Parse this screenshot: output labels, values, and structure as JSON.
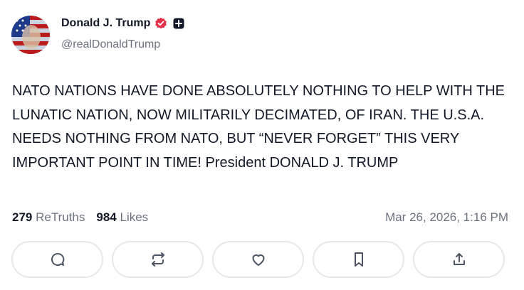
{
  "author": {
    "display_name": "Donald J. Trump",
    "handle": "@realDonaldTrump"
  },
  "post": {
    "text": "NATO NATIONS HAVE DONE ABSOLUTELY NOTHING TO HELP WITH THE LUNATIC NATION, NOW MILITARILY DECIMATED, OF IRAN. THE U.S.A. NEEDS NOTHING FROM NATO, BUT “NEVER FORGET” THIS VERY IMPORTANT POINT IN TIME! President DONALD J. TRUMP",
    "retruths_count": "279",
    "retruths_label": "ReTruths",
    "likes_count": "984",
    "likes_label": "Likes",
    "timestamp": "Mar 26, 2026, 1:16 PM"
  },
  "actions": [
    "reply-icon",
    "retruth-icon",
    "like-icon",
    "bookmark-icon",
    "share-icon"
  ],
  "colors": {
    "verified": "#e5304a",
    "text_primary": "#111827",
    "text_secondary": "#6b7280",
    "border": "#e5e7eb"
  }
}
